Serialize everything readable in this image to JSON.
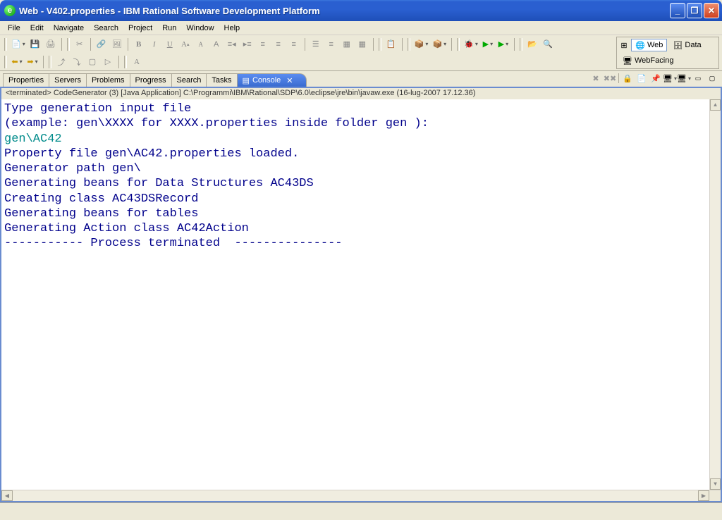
{
  "window": {
    "title": "Web - V402.properties - IBM Rational Software Development Platform"
  },
  "menubar": [
    "File",
    "Edit",
    "Navigate",
    "Search",
    "Project",
    "Run",
    "Window",
    "Help"
  ],
  "perspectives": {
    "web": "Web",
    "data": "Data",
    "webfacing": "WebFacing"
  },
  "tabs": {
    "properties": "Properties",
    "servers": "Servers",
    "problems": "Problems",
    "progress": "Progress",
    "search": "Search",
    "tasks": "Tasks",
    "console": "Console"
  },
  "console": {
    "header": "<terminated> CodeGenerator (3) [Java Application] C:\\Programmi\\IBM\\Rational\\SDP\\6.0\\eclipse\\jre\\bin\\javaw.exe (16-lug-2007 17.12.36)",
    "line1": "Type generation input file",
    "line2": "(example: gen\\XXXX for XXXX.properties inside folder gen ):",
    "input": "gen\\AC42",
    "line3": "Property file gen\\AC42.properties loaded.",
    "line4": "Generator path gen\\",
    "line5": "Generating beans for Data Structures AC43DS",
    "line6": "Creating class AC43DSRecord",
    "line7": "Generating beans for tables",
    "line8": "Generating Action class AC42Action",
    "line9": "----------- Process terminated  ---------------"
  }
}
